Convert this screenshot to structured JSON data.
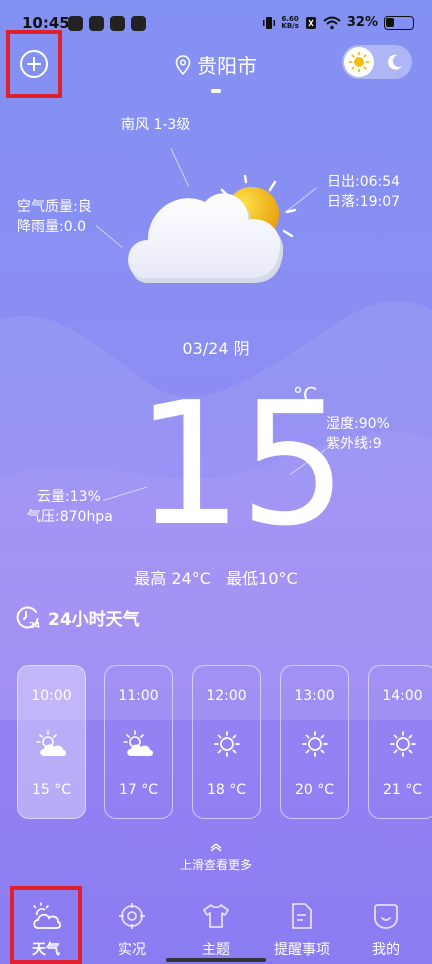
{
  "status_bar": {
    "time": "10:45",
    "net_speed_value": "6.60",
    "net_speed_unit": "KB/s",
    "battery": "32%",
    "battery_level": 0.32
  },
  "header": {
    "location": "贵阳市"
  },
  "weather": {
    "wind": "南风 1-3级",
    "air_quality": "空气质量:良",
    "rainfall": "降雨量:0.0",
    "sunrise": "日出:06:54",
    "sunset": "日落:19:07",
    "date_condition": "03/24 阴",
    "temperature": "15",
    "unit": "°C",
    "humidity": "湿度:90%",
    "uv": "紫外线:9",
    "cloud": "云量:13%",
    "pressure": "气压:870hpa",
    "high": "最高 24°C",
    "low": "最低10°C"
  },
  "hourly": {
    "title": "24小时天气",
    "icon_badge": "24",
    "items": [
      {
        "time": "10:00",
        "icon": "partly-cloudy-icon",
        "temp": "15 °C"
      },
      {
        "time": "11:00",
        "icon": "partly-cloudy-icon",
        "temp": "17 °C"
      },
      {
        "time": "12:00",
        "icon": "sunny-icon",
        "temp": "18 °C"
      },
      {
        "time": "13:00",
        "icon": "sunny-icon",
        "temp": "20 °C"
      },
      {
        "time": "14:00",
        "icon": "sunny-icon",
        "temp": "21 °C"
      }
    ],
    "swipe_hint": "上滑查看更多"
  },
  "nav": {
    "items": [
      {
        "label": "天气",
        "icon": "weather-icon"
      },
      {
        "label": "实况",
        "icon": "live-target-icon"
      },
      {
        "label": "主题",
        "icon": "shirt-icon"
      },
      {
        "label": "提醒事项",
        "icon": "document-icon"
      },
      {
        "label": "我的",
        "icon": "profile-icon"
      }
    ]
  },
  "colors": {
    "highlight": "#e0202c",
    "background_top": "#8391f2",
    "background_bottom": "#8a7df2",
    "sun": "#f4bd14"
  }
}
